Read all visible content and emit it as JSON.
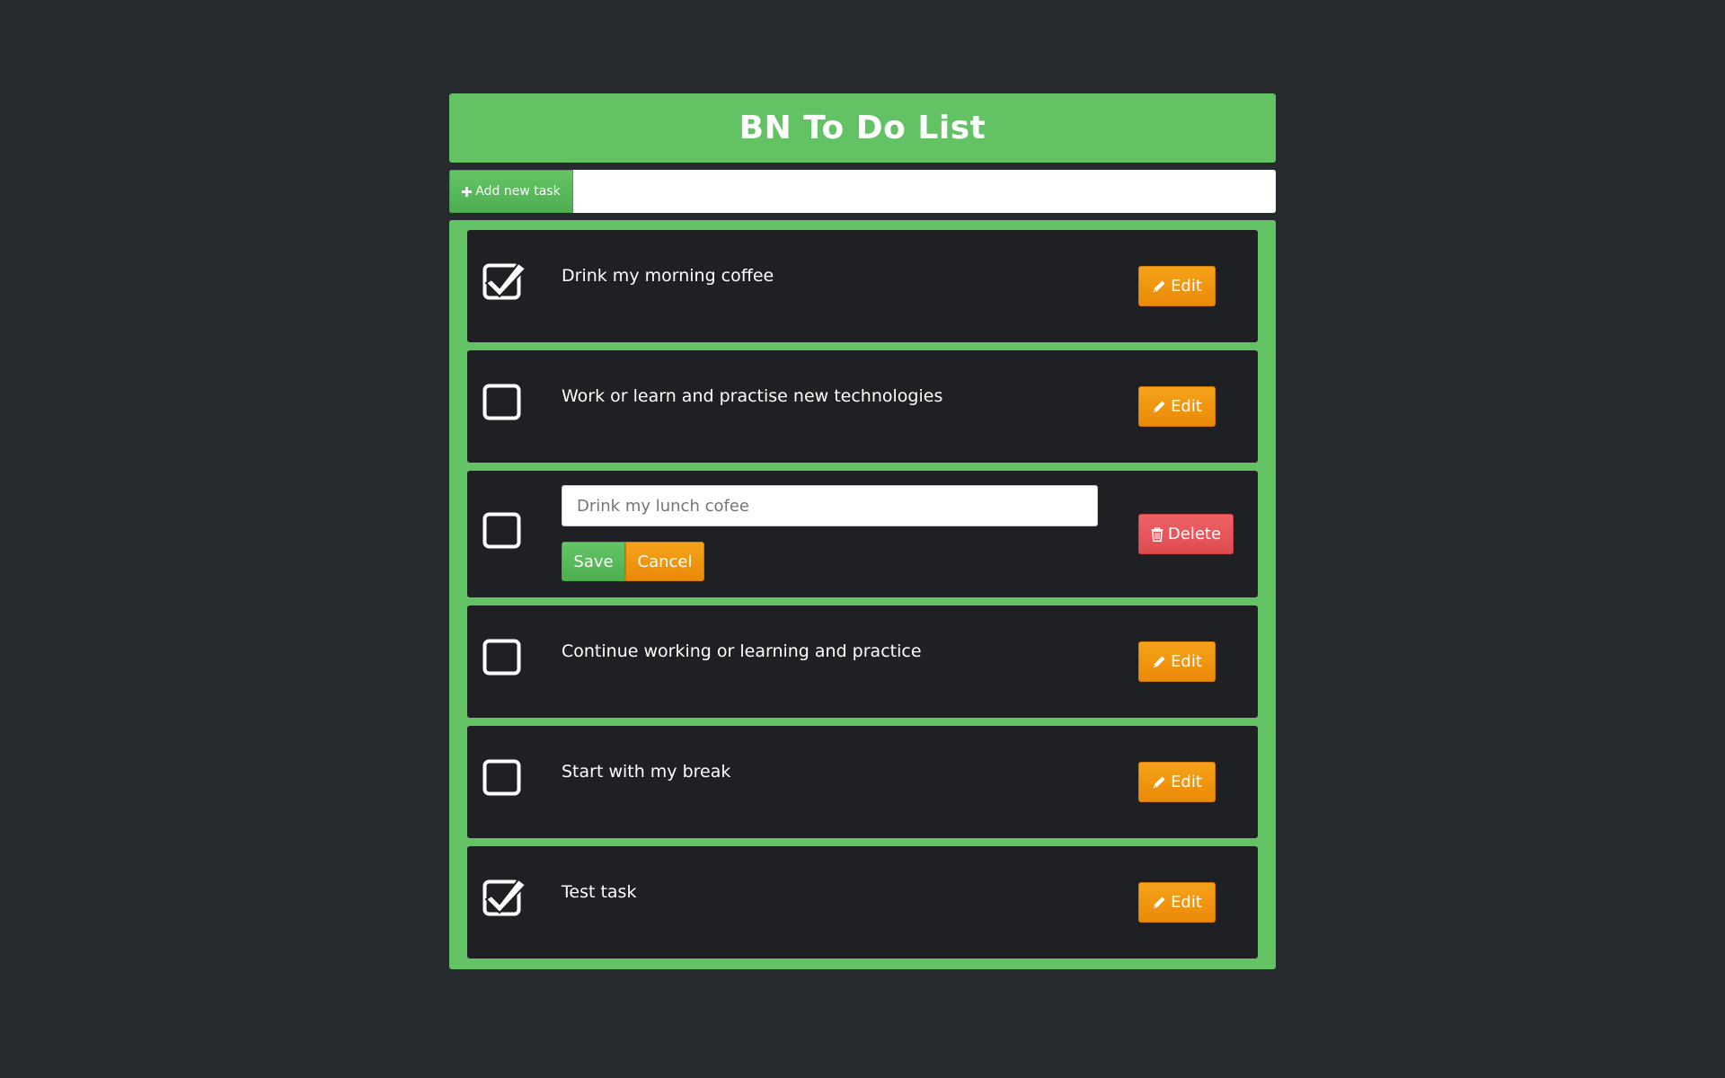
{
  "header": {
    "title": "BN To Do List"
  },
  "add_bar": {
    "button_label": "Add new task",
    "button_icon": "plus-icon",
    "input_value": ""
  },
  "tasks": [
    {
      "label": "Drink my morning coffee",
      "checked": true,
      "edit_label": "Edit"
    },
    {
      "label": "Work or learn and practise new technologies",
      "checked": false,
      "edit_label": "Edit"
    },
    {
      "editing": true,
      "checked": false,
      "input_placeholder": "Drink my lunch cofee",
      "save_label": "Save",
      "cancel_label": "Cancel",
      "delete_label": "Delete"
    },
    {
      "label": "Continue working or learning and practice",
      "checked": false,
      "edit_label": "Edit"
    },
    {
      "label": "Start with my break",
      "checked": false,
      "edit_label": "Edit"
    },
    {
      "label": "Test task",
      "checked": true,
      "edit_label": "Edit"
    }
  ],
  "colors": {
    "background": "#272a2f",
    "accent_green": "#62c264",
    "task_background": "#1f2024",
    "edit_orange": "#f29512",
    "delete_red": "#e85558"
  }
}
